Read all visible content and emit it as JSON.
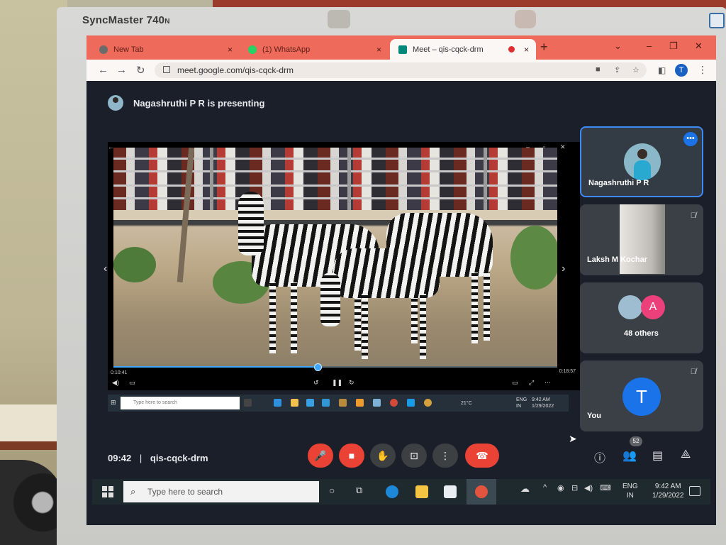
{
  "monitor": {
    "brand": "SyncMaster 740",
    "brand_suffix": "N"
  },
  "browser": {
    "tabs": [
      {
        "label": "New Tab",
        "close": "×"
      },
      {
        "label": "(1) WhatsApp",
        "close": "×"
      },
      {
        "label": "Meet – qis-cqck-drm",
        "close": "×"
      }
    ],
    "new_tab": "+",
    "window_controls": {
      "dropdown": "⌄",
      "minimize": "–",
      "restore": "❐",
      "close": "✕"
    },
    "url": "meet.google.com/qis-cqck-drm",
    "profile_initial": "T"
  },
  "meet": {
    "presenting_text": "Nagashruthi P R is presenting",
    "shared_video": {
      "elapsed": "0:10:41",
      "duration": "0:18:57",
      "progress_fraction": 0.46,
      "search_placeholder": "Type here to search",
      "temperature": "21°C",
      "lang": "ENG\nIN",
      "clock": "9:42 AM\n1/29/2022"
    },
    "participants": [
      {
        "name": "Nagashruthi P R"
      },
      {
        "name": "Laksh M Kochar"
      },
      {
        "name": "48 others",
        "avatar_letter": "A"
      },
      {
        "name": "You",
        "avatar_letter": "T"
      }
    ],
    "footer": {
      "time": "09:42",
      "separator": "|",
      "meeting_code": "qis-cqck-drm",
      "people_count": "52"
    }
  },
  "taskbar": {
    "search_placeholder": "Type here to search",
    "lang_line1": "ENG",
    "lang_line2": "IN",
    "time": "9:42 AM",
    "date": "1/29/2022"
  },
  "colors": {
    "meet_bg": "#1b1f2a",
    "end_call": "#ea4335",
    "accent": "#1a73e8",
    "chrome_frame": "#ee6a5b"
  }
}
